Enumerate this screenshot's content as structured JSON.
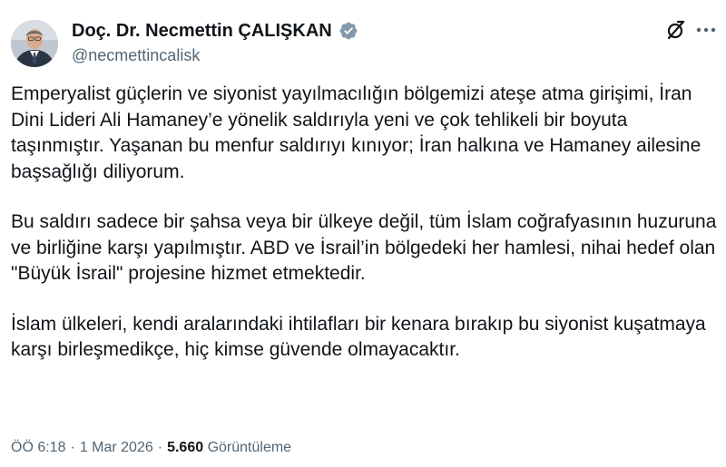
{
  "author": {
    "name": "Doç. Dr. Necmettin ÇALIŞKAN",
    "handle": "@necmettincalisk",
    "verified_color": "#829aab"
  },
  "icons": {
    "avatar": "profile-photo",
    "verified": "verified-badge-icon",
    "grok": "grok-icon",
    "more": "more-options-icon"
  },
  "tweet": {
    "paragraphs": [
      "Emperyalist güçlerin ve siyonist yayılmacılığın bölgemizi ateşe atma girişimi, İran Dini Lideri Ali Hamaney’e yönelik saldırıyla yeni ve çok tehlikeli bir boyuta taşınmıştır. Yaşanan bu menfur saldırıyı kınıyor; İran halkına ve Hamaney ailesine başsağlığı diliyorum.",
      "Bu saldırı sadece bir şahsa veya bir ülkeye değil, tüm İslam coğrafyasının huzuruna ve birliğine karşı yapılmıştır. ABD ve İsrail’in bölgedeki her hamlesi, nihai hedef olan \"Büyük İsrail\" projesine hizmet etmektedir.",
      "İslam ülkeleri, kendi aralarındaki ihtilafları bir kenara bırakıp bu siyonist kuşatmaya karşı birleşmedikçe, hiç kimse güvende olmayacaktır."
    ],
    "time": "ÖÖ 6:18",
    "date": "1 Mar 2026",
    "separator": "·",
    "views_count": "5.660",
    "views_label": "Görüntüleme"
  }
}
